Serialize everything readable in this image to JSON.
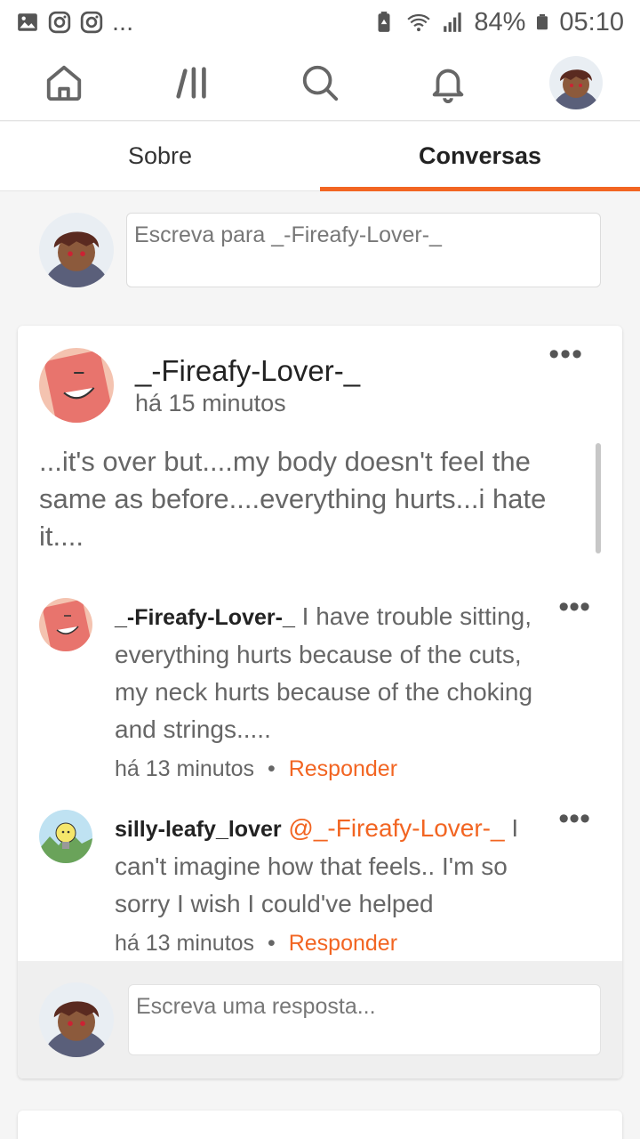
{
  "status_bar": {
    "left_icons": [
      "gallery-icon",
      "instagram-icon",
      "instagram-icon"
    ],
    "more": "...",
    "battery": "84%",
    "time": "05:10"
  },
  "nav": {
    "items": [
      "home-icon",
      "feed-icon",
      "search-icon",
      "bell-icon",
      "profile-avatar"
    ]
  },
  "tabs": [
    {
      "label": "Sobre",
      "active": false
    },
    {
      "label": "Conversas",
      "active": true
    }
  ],
  "composer": {
    "placeholder": "Escreva para _-Fireafy-Lover-_"
  },
  "post": {
    "author": "_-Fireafy-Lover-_",
    "time": "há 15 minutos",
    "body": "...it's over but....my body doesn't feel the same as before....everything hurts...i hate it....",
    "more": "•••"
  },
  "comments": [
    {
      "author": "_-Fireafy-Lover-_",
      "mention": "",
      "text": "I have trouble sitting, everything hurts because of the cuts, my neck hurts because of the choking and strings.....",
      "time": "há 13 minutos",
      "separator": "•",
      "reply": "Responder",
      "more": "•••"
    },
    {
      "author": "silly-leafy_lover",
      "mention": "@_-Fireafy-Lover-_",
      "text": "I can't imagine how that feels.. I'm so sorry I wish I could've helped",
      "time": "há 13 minutos",
      "separator": "•",
      "reply": "Responder",
      "more": "•••"
    }
  ],
  "reply_box": {
    "placeholder": "Escreva uma resposta..."
  },
  "colors": {
    "accent": "#f26522",
    "text": "#666666"
  }
}
